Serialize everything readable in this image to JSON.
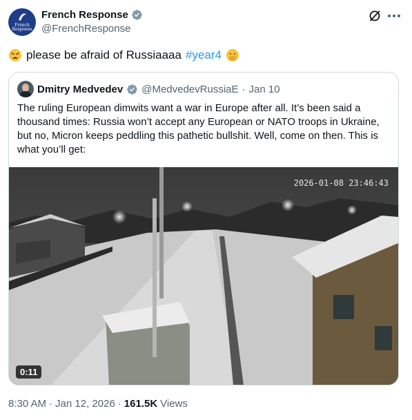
{
  "author": {
    "display_name": "French Response",
    "handle": "@FrenchResponse",
    "verified": true,
    "avatar_text": "French Response",
    "avatar_color": "#1f3c88"
  },
  "post": {
    "emoji_start": "weary-face",
    "text": "please be afraid of Russiaaaa",
    "hashtag": "#year4",
    "emoji_end": "face-with-hand-over-mouth"
  },
  "quote": {
    "display_name": "Dmitry Medvedev",
    "handle": "@MedvedevRussiaE",
    "separator": "·",
    "date": "Jan 10",
    "verified": true,
    "text": "The ruling European dimwits want a war in Europe after all. It’s been said a thousand times: Russia won’t accept any European or NATO troops in Ukraine, but no, Micron keeps peddling this pathetic bullshit. Well, come on then. This is what you’ll get:",
    "video": {
      "timestamp_overlay": "2026-01-08 23:46:43",
      "duration": "0:11"
    }
  },
  "meta": {
    "time": "8:30 AM",
    "separator1": "·",
    "date": "Jan 12, 2026",
    "separator2": "·",
    "views_count": "161.5K",
    "views_label": "Views"
  },
  "icons": {
    "verified": "verified-badge-icon",
    "grok": "grok-icon",
    "more": "more-icon"
  },
  "colors": {
    "accent": "#1d9bf0",
    "text_primary": "#0f1419",
    "text_secondary": "#536471",
    "border": "#cfd9de"
  }
}
